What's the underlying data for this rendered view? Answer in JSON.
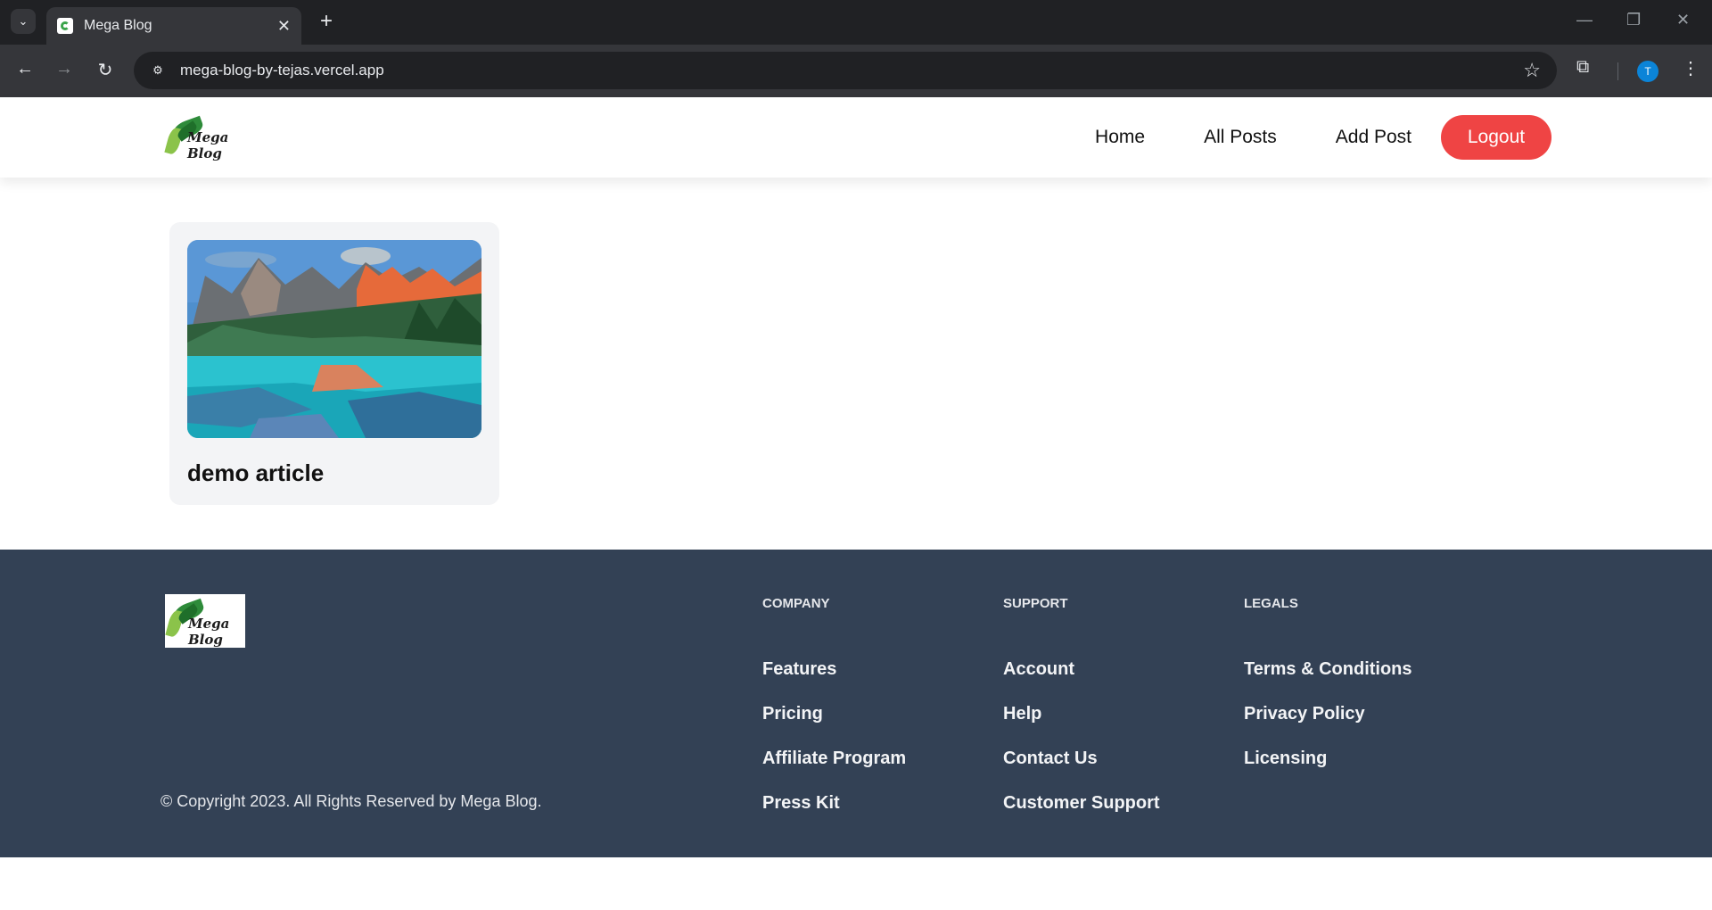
{
  "browser": {
    "tab_title": "Mega Blog",
    "url": "mega-blog-by-tejas.vercel.app",
    "profile_initial": "T"
  },
  "header": {
    "logo_text": "Mega Blog",
    "nav": [
      {
        "label": "Home"
      },
      {
        "label": "All Posts"
      },
      {
        "label": "Add Post"
      }
    ],
    "logout_label": "Logout"
  },
  "posts": [
    {
      "title": "demo article",
      "image": "mountain-lake-image"
    }
  ],
  "footer": {
    "logo_text": "Mega Blog",
    "copyright": "© Copyright 2023. All Rights Reserved by Mega Blog.",
    "columns": [
      {
        "heading": "COMPANY",
        "links": [
          "Features",
          "Pricing",
          "Affiliate Program",
          "Press Kit"
        ]
      },
      {
        "heading": "SUPPORT",
        "links": [
          "Account",
          "Help",
          "Contact Us",
          "Customer Support"
        ]
      },
      {
        "heading": "LEGALS",
        "links": [
          "Terms & Conditions",
          "Privacy Policy",
          "Licensing"
        ]
      }
    ]
  },
  "colors": {
    "logout": "#ef4444",
    "footer_bg": "#334155",
    "card_bg": "#f3f4f6"
  }
}
